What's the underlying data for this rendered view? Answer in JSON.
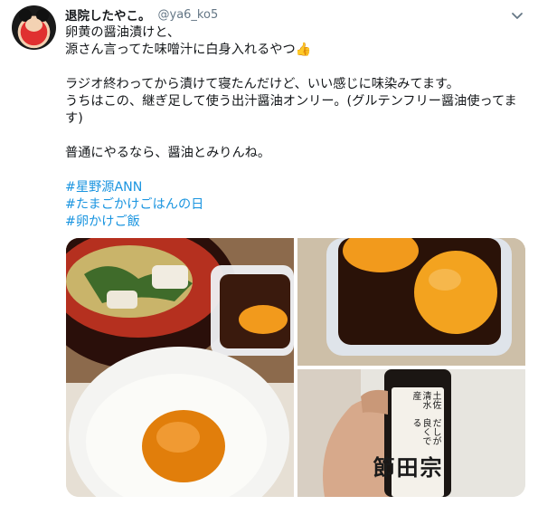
{
  "tweet": {
    "display_name": "退院したやこ。",
    "handle": "@ya6_ko5",
    "lines": [
      "卵黄の醤油漬けと、",
      "源さん言ってた味噌汁に白身入れるやつ👍",
      "",
      "ラジオ終わってから漬けて寝たんだけど、いい感じに味染みてます。",
      "うちはこの、継ぎ足して使う出汁醤油オンリー。(グルテンフリー醤油使ってます)",
      "",
      "普通にやるなら、醤油とみりんね。",
      ""
    ],
    "hashtags": [
      "#星野源ANN",
      "#たまごかけごはんの日",
      "#卵かけご飯"
    ]
  },
  "bottle_label": {
    "line1": "土佐清水産",
    "line2": "だしが良くでる",
    "line3": "宗田節"
  },
  "colors": {
    "link": "#1b95e0",
    "secondary_text": "#657786",
    "egg_yolk": "#f29a1c",
    "soy": "#2a1208"
  },
  "icons": {
    "menu": "chevron-down-icon",
    "emoji": "thumbs-up-emoji"
  }
}
